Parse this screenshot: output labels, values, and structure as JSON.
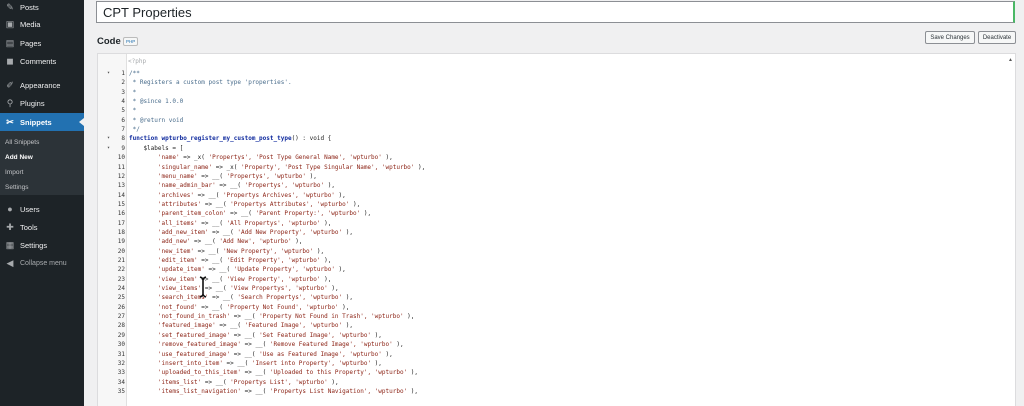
{
  "sidebar": {
    "items": [
      {
        "label": "Posts",
        "icon": "pin-icon",
        "glyph": "✎"
      },
      {
        "label": "Media",
        "icon": "media-icon",
        "glyph": "▣"
      },
      {
        "label": "Pages",
        "icon": "pages-icon",
        "glyph": "▤"
      },
      {
        "label": "Comments",
        "icon": "comments-icon",
        "glyph": "◼"
      },
      {
        "label": "Appearance",
        "icon": "brush-icon",
        "glyph": "✐"
      },
      {
        "label": "Plugins",
        "icon": "plugin-icon",
        "glyph": "⚲"
      },
      {
        "label": "Snippets",
        "icon": "scissors-icon",
        "glyph": "✂"
      },
      {
        "label": "Users",
        "icon": "users-icon",
        "glyph": "●"
      },
      {
        "label": "Tools",
        "icon": "wrench-icon",
        "glyph": "✚"
      },
      {
        "label": "Settings",
        "icon": "settings-icon",
        "glyph": "▦"
      }
    ],
    "submenu": [
      "All Snippets",
      "Add New",
      "Import",
      "Settings"
    ],
    "collapse_label": "Collapse menu",
    "accent": "#2271b1"
  },
  "title": "CPT Properties",
  "code_label": "Code",
  "code_badge": "PHP",
  "buttons": {
    "save": "Save Changes",
    "deactivate": "Deactivate"
  },
  "editor": {
    "php_open": "<?php",
    "lines": [
      {
        "n": "1",
        "fold": true,
        "segs": [
          {
            "t": "/**",
            "c": "cmt"
          }
        ]
      },
      {
        "n": "2",
        "segs": [
          {
            "t": " * Registers a custom post type 'properties'.",
            "c": "cmt"
          }
        ]
      },
      {
        "n": "3",
        "segs": [
          {
            "t": " *",
            "c": "cmt"
          }
        ]
      },
      {
        "n": "4",
        "segs": [
          {
            "t": " * @since 1.0.0",
            "c": "cmt"
          }
        ]
      },
      {
        "n": "5",
        "segs": [
          {
            "t": " *",
            "c": "cmt"
          }
        ]
      },
      {
        "n": "6",
        "segs": [
          {
            "t": " * @return void",
            "c": "cmt"
          }
        ]
      },
      {
        "n": "7",
        "segs": [
          {
            "t": " */",
            "c": "cmt"
          }
        ]
      },
      {
        "n": "8",
        "fold": true,
        "segs": [
          {
            "t": "function ",
            "c": "kw"
          },
          {
            "t": "wpturbo_register_my_custom_post_type",
            "c": "fn"
          },
          {
            "t": "() : void {",
            "c": ""
          }
        ]
      },
      {
        "n": "9",
        "fold": true,
        "segs": [
          {
            "t": "    $labels = [",
            "c": ""
          }
        ]
      },
      {
        "n": "10",
        "segs": [
          {
            "t": "        ",
            "c": ""
          },
          {
            "t": "'name'",
            "c": "str"
          },
          {
            "t": " => _x( ",
            "c": ""
          },
          {
            "t": "'Propertys', 'Post Type General Name', 'wpturbo'",
            "c": "str"
          },
          {
            "t": " ),",
            "c": ""
          }
        ]
      },
      {
        "n": "11",
        "segs": [
          {
            "t": "        ",
            "c": ""
          },
          {
            "t": "'singular_name'",
            "c": "str"
          },
          {
            "t": " => _x( ",
            "c": ""
          },
          {
            "t": "'Property', 'Post Type Singular Name', 'wpturbo'",
            "c": "str"
          },
          {
            "t": " ),",
            "c": ""
          }
        ]
      },
      {
        "n": "12",
        "segs": [
          {
            "t": "        ",
            "c": ""
          },
          {
            "t": "'menu_name'",
            "c": "str"
          },
          {
            "t": " => __( ",
            "c": ""
          },
          {
            "t": "'Propertys', 'wpturbo'",
            "c": "str"
          },
          {
            "t": " ),",
            "c": ""
          }
        ]
      },
      {
        "n": "13",
        "segs": [
          {
            "t": "        ",
            "c": ""
          },
          {
            "t": "'name_admin_bar'",
            "c": "str"
          },
          {
            "t": " => __( ",
            "c": ""
          },
          {
            "t": "'Propertys', 'wpturbo'",
            "c": "str"
          },
          {
            "t": " ),",
            "c": ""
          }
        ]
      },
      {
        "n": "14",
        "segs": [
          {
            "t": "        ",
            "c": ""
          },
          {
            "t": "'archives'",
            "c": "str"
          },
          {
            "t": " => __( ",
            "c": ""
          },
          {
            "t": "'Propertys Archives', 'wpturbo'",
            "c": "str"
          },
          {
            "t": " ),",
            "c": ""
          }
        ]
      },
      {
        "n": "15",
        "segs": [
          {
            "t": "        ",
            "c": ""
          },
          {
            "t": "'attributes'",
            "c": "str"
          },
          {
            "t": " => __( ",
            "c": ""
          },
          {
            "t": "'Propertys Attributes', 'wpturbo'",
            "c": "str"
          },
          {
            "t": " ),",
            "c": ""
          }
        ]
      },
      {
        "n": "16",
        "segs": [
          {
            "t": "        ",
            "c": ""
          },
          {
            "t": "'parent_item_colon'",
            "c": "str"
          },
          {
            "t": " => __( ",
            "c": ""
          },
          {
            "t": "'Parent Property:', 'wpturbo'",
            "c": "str"
          },
          {
            "t": " ),",
            "c": ""
          }
        ]
      },
      {
        "n": "17",
        "segs": [
          {
            "t": "        ",
            "c": ""
          },
          {
            "t": "'all_items'",
            "c": "str"
          },
          {
            "t": " => __( ",
            "c": ""
          },
          {
            "t": "'All Propertys', 'wpturbo'",
            "c": "str"
          },
          {
            "t": " ),",
            "c": ""
          }
        ]
      },
      {
        "n": "18",
        "segs": [
          {
            "t": "        ",
            "c": ""
          },
          {
            "t": "'add_new_item'",
            "c": "str"
          },
          {
            "t": " => __( ",
            "c": ""
          },
          {
            "t": "'Add New Property', 'wpturbo'",
            "c": "str"
          },
          {
            "t": " ),",
            "c": ""
          }
        ]
      },
      {
        "n": "19",
        "segs": [
          {
            "t": "        ",
            "c": ""
          },
          {
            "t": "'add_new'",
            "c": "str"
          },
          {
            "t": " => __( ",
            "c": ""
          },
          {
            "t": "'Add New', 'wpturbo'",
            "c": "str"
          },
          {
            "t": " ),",
            "c": ""
          }
        ]
      },
      {
        "n": "20",
        "segs": [
          {
            "t": "        ",
            "c": ""
          },
          {
            "t": "'new_item'",
            "c": "str"
          },
          {
            "t": " => __( ",
            "c": ""
          },
          {
            "t": "'New Property', 'wpturbo'",
            "c": "str"
          },
          {
            "t": " ),",
            "c": ""
          }
        ]
      },
      {
        "n": "21",
        "segs": [
          {
            "t": "        ",
            "c": ""
          },
          {
            "t": "'edit_item'",
            "c": "str"
          },
          {
            "t": " => __( ",
            "c": ""
          },
          {
            "t": "'Edit Property', 'wpturbo'",
            "c": "str"
          },
          {
            "t": " ),",
            "c": ""
          }
        ]
      },
      {
        "n": "22",
        "segs": [
          {
            "t": "        ",
            "c": ""
          },
          {
            "t": "'update_item'",
            "c": "str"
          },
          {
            "t": " => __( ",
            "c": ""
          },
          {
            "t": "'Update Property', 'wpturbo'",
            "c": "str"
          },
          {
            "t": " ),",
            "c": ""
          }
        ]
      },
      {
        "n": "23",
        "segs": [
          {
            "t": "        ",
            "c": ""
          },
          {
            "t": "'view_item'",
            "c": "str"
          },
          {
            "t": " => __( ",
            "c": ""
          },
          {
            "t": "'View Property', 'wpturbo'",
            "c": "str"
          },
          {
            "t": " ),",
            "c": ""
          }
        ]
      },
      {
        "n": "24",
        "segs": [
          {
            "t": "        ",
            "c": ""
          },
          {
            "t": "'view_items'",
            "c": "str"
          },
          {
            "t": " => __( ",
            "c": ""
          },
          {
            "t": "'View Propertys', 'wpturbo'",
            "c": "str"
          },
          {
            "t": " ),",
            "c": ""
          }
        ]
      },
      {
        "n": "25",
        "segs": [
          {
            "t": "        ",
            "c": ""
          },
          {
            "t": "'search_items'",
            "c": "str"
          },
          {
            "t": " => __( ",
            "c": ""
          },
          {
            "t": "'Search Propertys', 'wpturbo'",
            "c": "str"
          },
          {
            "t": " ),",
            "c": ""
          }
        ]
      },
      {
        "n": "26",
        "segs": [
          {
            "t": "        ",
            "c": ""
          },
          {
            "t": "'not_found'",
            "c": "str"
          },
          {
            "t": " => __( ",
            "c": ""
          },
          {
            "t": "'Property Not Found', 'wpturbo'",
            "c": "str"
          },
          {
            "t": " ),",
            "c": ""
          }
        ]
      },
      {
        "n": "27",
        "segs": [
          {
            "t": "        ",
            "c": ""
          },
          {
            "t": "'not_found_in_trash'",
            "c": "str"
          },
          {
            "t": " => __( ",
            "c": ""
          },
          {
            "t": "'Property Not Found in Trash', 'wpturbo'",
            "c": "str"
          },
          {
            "t": " ),",
            "c": ""
          }
        ]
      },
      {
        "n": "28",
        "segs": [
          {
            "t": "        ",
            "c": ""
          },
          {
            "t": "'featured_image'",
            "c": "str"
          },
          {
            "t": " => __( ",
            "c": ""
          },
          {
            "t": "'Featured Image', 'wpturbo'",
            "c": "str"
          },
          {
            "t": " ),",
            "c": ""
          }
        ]
      },
      {
        "n": "29",
        "segs": [
          {
            "t": "        ",
            "c": ""
          },
          {
            "t": "'set_featured_image'",
            "c": "str"
          },
          {
            "t": " => __( ",
            "c": ""
          },
          {
            "t": "'Set Featured Image', 'wpturbo'",
            "c": "str"
          },
          {
            "t": " ),",
            "c": ""
          }
        ]
      },
      {
        "n": "30",
        "segs": [
          {
            "t": "        ",
            "c": ""
          },
          {
            "t": "'remove_featured_image'",
            "c": "str"
          },
          {
            "t": " => __( ",
            "c": ""
          },
          {
            "t": "'Remove Featured Image', 'wpturbo'",
            "c": "str"
          },
          {
            "t": " ),",
            "c": ""
          }
        ]
      },
      {
        "n": "31",
        "segs": [
          {
            "t": "        ",
            "c": ""
          },
          {
            "t": "'use_featured_image'",
            "c": "str"
          },
          {
            "t": " => __( ",
            "c": ""
          },
          {
            "t": "'Use as Featured Image', 'wpturbo'",
            "c": "str"
          },
          {
            "t": " ),",
            "c": ""
          }
        ]
      },
      {
        "n": "32",
        "segs": [
          {
            "t": "        ",
            "c": ""
          },
          {
            "t": "'insert_into_item'",
            "c": "str"
          },
          {
            "t": " => __( ",
            "c": ""
          },
          {
            "t": "'Insert into Property', 'wpturbo'",
            "c": "str"
          },
          {
            "t": " ),",
            "c": ""
          }
        ]
      },
      {
        "n": "33",
        "segs": [
          {
            "t": "        ",
            "c": ""
          },
          {
            "t": "'uploaded_to_this_item'",
            "c": "str"
          },
          {
            "t": " => __( ",
            "c": ""
          },
          {
            "t": "'Uploaded to this Property', 'wpturbo'",
            "c": "str"
          },
          {
            "t": " ),",
            "c": ""
          }
        ]
      },
      {
        "n": "34",
        "segs": [
          {
            "t": "        ",
            "c": ""
          },
          {
            "t": "'items_list'",
            "c": "str"
          },
          {
            "t": " => __( ",
            "c": ""
          },
          {
            "t": "'Propertys List', 'wpturbo'",
            "c": "str"
          },
          {
            "t": " ),",
            "c": ""
          }
        ]
      },
      {
        "n": "35",
        "segs": [
          {
            "t": "        ",
            "c": ""
          },
          {
            "t": "'items_list_navigation'",
            "c": "str"
          },
          {
            "t": " => __( ",
            "c": ""
          },
          {
            "t": "'Propertys List Navigation', 'wpturbo'",
            "c": "str"
          },
          {
            "t": " ),",
            "c": ""
          }
        ]
      }
    ]
  }
}
